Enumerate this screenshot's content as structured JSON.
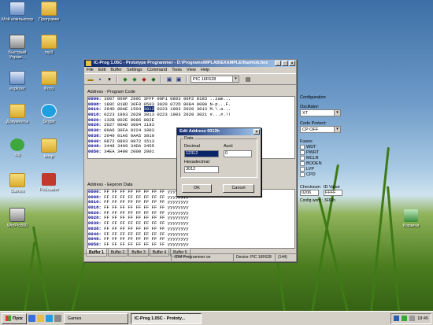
{
  "desktop": {
    "icons": [
      {
        "label": "Мой компьютер",
        "icon": "computer-icon"
      },
      {
        "label": "Программ",
        "icon": "folder-icon"
      },
      {
        "label": "Быстрый Упраж...",
        "icon": "program-icon"
      },
      {
        "label": "mp3",
        "icon": "folder-icon"
      },
      {
        "label": "explorer",
        "icon": "explorer-icon"
      },
      {
        "label": "Фото",
        "icon": "folder-icon"
      },
      {
        "label": "Документы",
        "icon": "documents-icon"
      },
      {
        "label": "Skype",
        "icon": "skype-icon"
      },
      {
        "label": "icq",
        "icon": "icq-icon"
      },
      {
        "label": "temp",
        "icon": "folder-icon"
      },
      {
        "label": "Games",
        "icon": "folder-icon"
      },
      {
        "label": "PicLoader",
        "icon": "program-icon"
      },
      {
        "label": "WinPic800",
        "icon": "program-icon"
      },
      {
        "label": "Корзина",
        "icon": "recycle-bin-icon"
      }
    ]
  },
  "window": {
    "title": "IC-Prog 1.05C - Prototype Programmer - D:\\Programs\\MPLAB\\EXAMPLE\\flash\\ok.hex",
    "menu": [
      "File",
      "Edit",
      "Buffer",
      "Settings",
      "Command",
      "Tools",
      "View",
      "Help"
    ],
    "device_combo": "PIC 16F628",
    "program_code_label": "Address - Program Code",
    "eeprom_label": "Address - Eeprom Data",
    "code_rows": [
      {
        "addr": "0000:",
        "hex": "3007 009F 289C 3FFF 00F1 0803 00F2 0183",
        "ascii": "..zam...",
        "sel": -1
      },
      {
        "addr": "0008:",
        "hex": "180C 018D 30F0 0503 3020 072D 0084 0000",
        "ascii": "N-p...F.",
        "sel": -1
      },
      {
        "addr": "0010:",
        "hex": "204D 00AE 1503 3012 0223 1903 2020 3013",
        "ascii": "M.\\.a...",
        "sel": 3
      },
      {
        "addr": "0018:",
        "hex": "0223 1903 2020 3013 0223 1903 2020 3021",
        "ascii": "#...#.!!",
        "sel": -1
      },
      {
        "addr": "0020:",
        "hex": "132B 002E 0086 082E",
        "ascii": "",
        "sel": -1
      },
      {
        "addr": "0028:",
        "hex": "2027 00AD 3004 1183",
        "ascii": "",
        "sel": -1
      },
      {
        "addr": "0030:",
        "hex": "00A6 30FA 0224 1903",
        "ascii": "",
        "sel": -1
      },
      {
        "addr": "0038:",
        "hex": "2040 01A6 0AA5 3010",
        "ascii": "",
        "sel": -1
      },
      {
        "addr": "0040:",
        "hex": "0872 0803 0872 1513",
        "ascii": "",
        "sel": -1
      },
      {
        "addr": "0048:",
        "hex": "3448 3409 34DA 3455",
        "ascii": "",
        "sel": -1
      },
      {
        "addr": "0050:",
        "hex": "34EA 3400 2000 2001",
        "ascii": "",
        "sel": -1
      }
    ],
    "eeprom_rows": [
      {
        "addr": "0000:",
        "hex": "FF FF FF FF FF FF FF FF",
        "ascii": "yyyyyyyy"
      },
      {
        "addr": "0008:",
        "hex": "FF FF FF FF FF FF FF FF",
        "ascii": "yyyyyyyy"
      },
      {
        "addr": "0010:",
        "hex": "FF FF FF FF FF FF FF FF",
        "ascii": "yyyyyyyy"
      },
      {
        "addr": "0018:",
        "hex": "FF FF FF FF FF FF FF FF",
        "ascii": "yyyyyyyy"
      },
      {
        "addr": "0020:",
        "hex": "FF FF FF FF FF FF FF FF",
        "ascii": "yyyyyyyy"
      },
      {
        "addr": "0028:",
        "hex": "FF FF FF FF FF FF FF FF",
        "ascii": "yyyyyyyy"
      },
      {
        "addr": "0030:",
        "hex": "FF FF FF FF FF FF FF FF",
        "ascii": "yyyyyyyy"
      },
      {
        "addr": "0038:",
        "hex": "FF FF FF FF FF FF FF FF",
        "ascii": "yyyyyyyy"
      },
      {
        "addr": "0040:",
        "hex": "FF FF FF FF FF FF FF FF",
        "ascii": "yyyyyyyy"
      },
      {
        "addr": "0048:",
        "hex": "FF FF FF FF FF FF FF FF",
        "ascii": "yyyyyyyy"
      },
      {
        "addr": "0050:",
        "hex": "FF FF FF FF FF FF FF FF",
        "ascii": "yyyyyyyy"
      },
      {
        "addr": "0058:",
        "hex": "FF FF FF FF FF FF FF FF",
        "ascii": "yyyyyyyy"
      }
    ],
    "config": {
      "title": "Configuration",
      "oscillator_label": "Oscillator:",
      "oscillator_value": "XT",
      "code_protect_label": "Code Protect:",
      "code_protect_value": "CP OFF",
      "fuses_label": "Fuses:",
      "fuses": [
        "WDT",
        "PWRT",
        "MCLR",
        "BODEN",
        "LVP",
        "CPD"
      ],
      "checksum_label": "Checksum",
      "checksum_value": "0206",
      "id_label": "ID Value",
      "id_value": "FFFF",
      "config_word": "Config word : 3F69h"
    },
    "tabs": [
      "Buffer 1",
      "Buffer 2",
      "Buffer 3",
      "Buffer 4",
      "Buffer 5"
    ],
    "status": {
      "programmer": "JDM Programmer on",
      "device": "Device: PIC 16F628",
      "ops": "(144)"
    }
  },
  "dialog": {
    "title": "Edit Address 0013h",
    "group_label": "Data",
    "decimal_label": "Decimal",
    "decimal_value": "12312",
    "ascii_label": "Ascii",
    "ascii_value": "0",
    "hex_label": "Hexadecimal",
    "hex_value": "3012",
    "ok_label": "OK",
    "cancel_label": "Cancel"
  },
  "taskbar": {
    "start_label": "Пуск",
    "tasks": [
      "Games",
      "IC-Prog 1.05C - Prototy..."
    ],
    "clock": "18:45"
  }
}
